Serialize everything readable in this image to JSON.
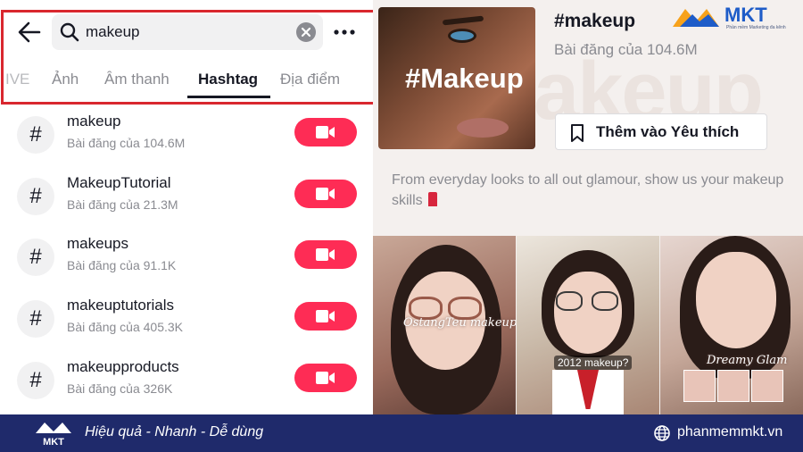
{
  "search": {
    "query": "makeup"
  },
  "tabs": [
    "IVE",
    "Ảnh",
    "Âm thanh",
    "Hashtag",
    "Địa điểm"
  ],
  "active_tab": "Hashtag",
  "results": [
    {
      "name": "makeup",
      "posts": "Bài đăng của 104.6M"
    },
    {
      "name": "MakeupTutorial",
      "posts": "Bài đăng của 21.3M"
    },
    {
      "name": "makeups",
      "posts": "Bài đăng của 91.1K"
    },
    {
      "name": "makeuptutorials",
      "posts": "Bài đăng của 405.3K"
    },
    {
      "name": "makeupproducts",
      "posts": "Bài đăng của 326K"
    }
  ],
  "hashtag_page": {
    "title": "#makeup",
    "posts": "Bài đăng của 104.6M",
    "cover_text": "#Makeup",
    "ghost_text": "akeup",
    "favorite_label": "Thêm vào Yêu thích",
    "description": "From everyday looks to all out glamour, show us your makeup skills",
    "video_captions": [
      "OstangTeu makeup Tutorial",
      "2012 makeup?",
      "Dreamy Glam"
    ]
  },
  "brand": {
    "name": "MKT",
    "tagline": "Phần mềm Marketing đa kênh",
    "slogan": "Hiệu quả - Nhanh - Dễ dùng",
    "website": "phanmemmkt.vn"
  },
  "colors": {
    "accent": "#fe2c55",
    "frame": "#d9272e",
    "bar": "#1f2a6b",
    "brand": "#1e5cc8"
  },
  "icons": [
    "back-arrow-icon",
    "search-icon",
    "clear-icon",
    "more-icon",
    "hashtag-icon",
    "video-camera-icon",
    "bookmark-icon",
    "lipstick-icon",
    "globe-icon"
  ]
}
